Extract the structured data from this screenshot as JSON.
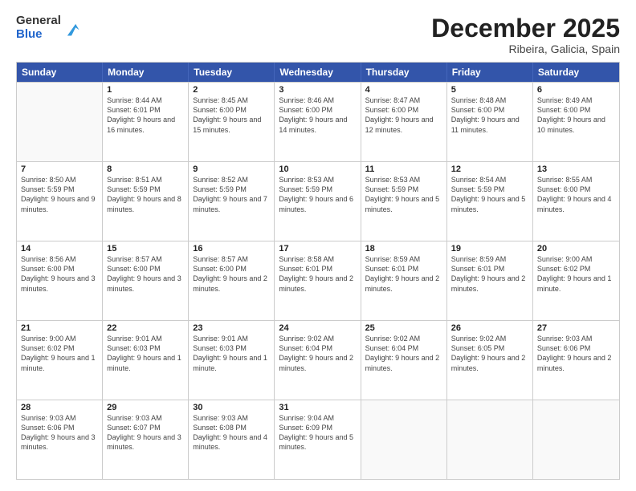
{
  "logo": {
    "general": "General",
    "blue": "Blue"
  },
  "title": "December 2025",
  "location": "Ribeira, Galicia, Spain",
  "days_of_week": [
    "Sunday",
    "Monday",
    "Tuesday",
    "Wednesday",
    "Thursday",
    "Friday",
    "Saturday"
  ],
  "weeks": [
    [
      {
        "day": "",
        "sunrise": "",
        "sunset": "",
        "daylight": ""
      },
      {
        "day": "1",
        "sunrise": "Sunrise: 8:44 AM",
        "sunset": "Sunset: 6:01 PM",
        "daylight": "Daylight: 9 hours and 16 minutes."
      },
      {
        "day": "2",
        "sunrise": "Sunrise: 8:45 AM",
        "sunset": "Sunset: 6:00 PM",
        "daylight": "Daylight: 9 hours and 15 minutes."
      },
      {
        "day": "3",
        "sunrise": "Sunrise: 8:46 AM",
        "sunset": "Sunset: 6:00 PM",
        "daylight": "Daylight: 9 hours and 14 minutes."
      },
      {
        "day": "4",
        "sunrise": "Sunrise: 8:47 AM",
        "sunset": "Sunset: 6:00 PM",
        "daylight": "Daylight: 9 hours and 12 minutes."
      },
      {
        "day": "5",
        "sunrise": "Sunrise: 8:48 AM",
        "sunset": "Sunset: 6:00 PM",
        "daylight": "Daylight: 9 hours and 11 minutes."
      },
      {
        "day": "6",
        "sunrise": "Sunrise: 8:49 AM",
        "sunset": "Sunset: 6:00 PM",
        "daylight": "Daylight: 9 hours and 10 minutes."
      }
    ],
    [
      {
        "day": "7",
        "sunrise": "Sunrise: 8:50 AM",
        "sunset": "Sunset: 5:59 PM",
        "daylight": "Daylight: 9 hours and 9 minutes."
      },
      {
        "day": "8",
        "sunrise": "Sunrise: 8:51 AM",
        "sunset": "Sunset: 5:59 PM",
        "daylight": "Daylight: 9 hours and 8 minutes."
      },
      {
        "day": "9",
        "sunrise": "Sunrise: 8:52 AM",
        "sunset": "Sunset: 5:59 PM",
        "daylight": "Daylight: 9 hours and 7 minutes."
      },
      {
        "day": "10",
        "sunrise": "Sunrise: 8:53 AM",
        "sunset": "Sunset: 5:59 PM",
        "daylight": "Daylight: 9 hours and 6 minutes."
      },
      {
        "day": "11",
        "sunrise": "Sunrise: 8:53 AM",
        "sunset": "Sunset: 5:59 PM",
        "daylight": "Daylight: 9 hours and 5 minutes."
      },
      {
        "day": "12",
        "sunrise": "Sunrise: 8:54 AM",
        "sunset": "Sunset: 5:59 PM",
        "daylight": "Daylight: 9 hours and 5 minutes."
      },
      {
        "day": "13",
        "sunrise": "Sunrise: 8:55 AM",
        "sunset": "Sunset: 6:00 PM",
        "daylight": "Daylight: 9 hours and 4 minutes."
      }
    ],
    [
      {
        "day": "14",
        "sunrise": "Sunrise: 8:56 AM",
        "sunset": "Sunset: 6:00 PM",
        "daylight": "Daylight: 9 hours and 3 minutes."
      },
      {
        "day": "15",
        "sunrise": "Sunrise: 8:57 AM",
        "sunset": "Sunset: 6:00 PM",
        "daylight": "Daylight: 9 hours and 3 minutes."
      },
      {
        "day": "16",
        "sunrise": "Sunrise: 8:57 AM",
        "sunset": "Sunset: 6:00 PM",
        "daylight": "Daylight: 9 hours and 2 minutes."
      },
      {
        "day": "17",
        "sunrise": "Sunrise: 8:58 AM",
        "sunset": "Sunset: 6:01 PM",
        "daylight": "Daylight: 9 hours and 2 minutes."
      },
      {
        "day": "18",
        "sunrise": "Sunrise: 8:59 AM",
        "sunset": "Sunset: 6:01 PM",
        "daylight": "Daylight: 9 hours and 2 minutes."
      },
      {
        "day": "19",
        "sunrise": "Sunrise: 8:59 AM",
        "sunset": "Sunset: 6:01 PM",
        "daylight": "Daylight: 9 hours and 2 minutes."
      },
      {
        "day": "20",
        "sunrise": "Sunrise: 9:00 AM",
        "sunset": "Sunset: 6:02 PM",
        "daylight": "Daylight: 9 hours and 1 minute."
      }
    ],
    [
      {
        "day": "21",
        "sunrise": "Sunrise: 9:00 AM",
        "sunset": "Sunset: 6:02 PM",
        "daylight": "Daylight: 9 hours and 1 minute."
      },
      {
        "day": "22",
        "sunrise": "Sunrise: 9:01 AM",
        "sunset": "Sunset: 6:03 PM",
        "daylight": "Daylight: 9 hours and 1 minute."
      },
      {
        "day": "23",
        "sunrise": "Sunrise: 9:01 AM",
        "sunset": "Sunset: 6:03 PM",
        "daylight": "Daylight: 9 hours and 1 minute."
      },
      {
        "day": "24",
        "sunrise": "Sunrise: 9:02 AM",
        "sunset": "Sunset: 6:04 PM",
        "daylight": "Daylight: 9 hours and 2 minutes."
      },
      {
        "day": "25",
        "sunrise": "Sunrise: 9:02 AM",
        "sunset": "Sunset: 6:04 PM",
        "daylight": "Daylight: 9 hours and 2 minutes."
      },
      {
        "day": "26",
        "sunrise": "Sunrise: 9:02 AM",
        "sunset": "Sunset: 6:05 PM",
        "daylight": "Daylight: 9 hours and 2 minutes."
      },
      {
        "day": "27",
        "sunrise": "Sunrise: 9:03 AM",
        "sunset": "Sunset: 6:06 PM",
        "daylight": "Daylight: 9 hours and 2 minutes."
      }
    ],
    [
      {
        "day": "28",
        "sunrise": "Sunrise: 9:03 AM",
        "sunset": "Sunset: 6:06 PM",
        "daylight": "Daylight: 9 hours and 3 minutes."
      },
      {
        "day": "29",
        "sunrise": "Sunrise: 9:03 AM",
        "sunset": "Sunset: 6:07 PM",
        "daylight": "Daylight: 9 hours and 3 minutes."
      },
      {
        "day": "30",
        "sunrise": "Sunrise: 9:03 AM",
        "sunset": "Sunset: 6:08 PM",
        "daylight": "Daylight: 9 hours and 4 minutes."
      },
      {
        "day": "31",
        "sunrise": "Sunrise: 9:04 AM",
        "sunset": "Sunset: 6:09 PM",
        "daylight": "Daylight: 9 hours and 5 minutes."
      },
      {
        "day": "",
        "sunrise": "",
        "sunset": "",
        "daylight": ""
      },
      {
        "day": "",
        "sunrise": "",
        "sunset": "",
        "daylight": ""
      },
      {
        "day": "",
        "sunrise": "",
        "sunset": "",
        "daylight": ""
      }
    ]
  ]
}
